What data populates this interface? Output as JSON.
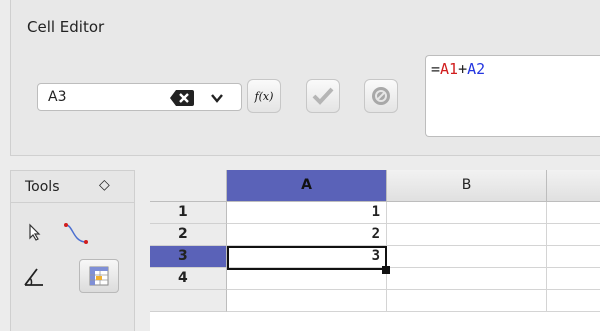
{
  "cell_editor": {
    "title": "Cell Editor",
    "name_box_value": "A3",
    "formula": {
      "prefix": "=",
      "ref1": "A1",
      "operator": "+",
      "ref2": "A2"
    },
    "buttons": {
      "fx": "f(x)"
    }
  },
  "tools": {
    "label": "Tools",
    "toggle_glyph": "◇"
  },
  "sheet": {
    "columns": [
      "A",
      "B"
    ],
    "rows": [
      {
        "num": "1",
        "a": "1"
      },
      {
        "num": "2",
        "a": "2"
      },
      {
        "num": "3",
        "a": "3"
      },
      {
        "num": "4",
        "a": ""
      }
    ],
    "selected_row": "3",
    "selected_col": "A",
    "colors": {
      "selection": "#5a62b8",
      "ref1": "#d11d1d",
      "ref2": "#2436e0"
    }
  }
}
